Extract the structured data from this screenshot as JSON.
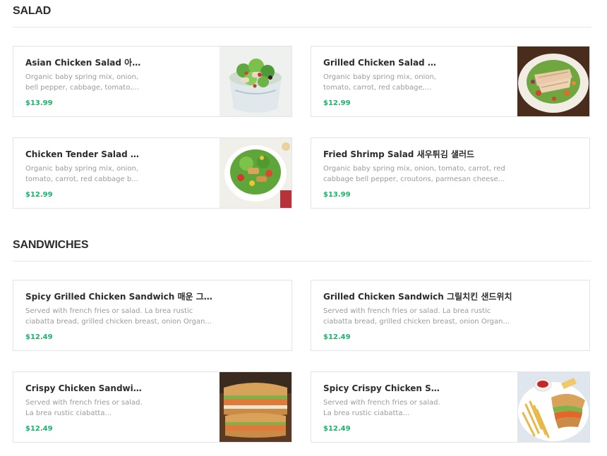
{
  "sections": [
    {
      "title": "SALAD",
      "items": [
        {
          "name": "Asian Chicken Salad 아시안 ...",
          "description": "Organic baby spring mix, onion, bell pepper, cabbage, tomato,...",
          "price": "$13.99",
          "image": "asian-chicken-salad-photo"
        },
        {
          "name": "Grilled Chicken Salad 그릴...",
          "description": "Organic baby spring mix, onion, tomato, carrot, red cabbage,...",
          "price": "$12.99",
          "image": "grilled-chicken-salad-photo"
        },
        {
          "name": "Chicken Tender Salad 치킨...",
          "description": "Organic baby spring mix, onion, tomato, carrot, red cabbage b...",
          "price": "$12.99",
          "image": "chicken-tender-salad-photo"
        },
        {
          "name": "Fried Shrimp Salad 새우튀김 샐러드",
          "description": "Organic baby spring mix, onion, tomato, carrot, red cabbage bell pepper, croutons, parmesan cheese...",
          "price": "$13.99",
          "image": null
        }
      ]
    },
    {
      "title": "SANDWICHES",
      "items": [
        {
          "name": "Spicy Grilled Chicken Sandwich 매운 그릴치킨 ...",
          "description": "Served with french fries or salad. La brea rustic ciabatta bread, grilled chicken breast, onion Organ...",
          "price": "$12.49",
          "image": null
        },
        {
          "name": "Grilled Chicken Sandwich 그릴치킨 샌드위치",
          "description": "Served with french fries or salad. La brea rustic ciabatta bread, grilled chicken breast, onion Organ...",
          "price": "$12.49",
          "image": null
        },
        {
          "name": "Crispy Chicken Sandwich ...",
          "description": "Served with french fries or salad. La brea rustic ciabatta...",
          "price": "$12.49",
          "image": "crispy-chicken-sandwich-photo"
        },
        {
          "name": "Spicy Crispy Chicken Sand...",
          "description": "Served with french fries or salad. La brea rustic ciabatta...",
          "price": "$12.49",
          "image": "spicy-crispy-chicken-sandwich-photo"
        }
      ]
    }
  ],
  "colors": {
    "price": "#19b56b",
    "border": "#e4e4e4",
    "title": "#2d2d2d",
    "muted": "#9b9b9b"
  }
}
